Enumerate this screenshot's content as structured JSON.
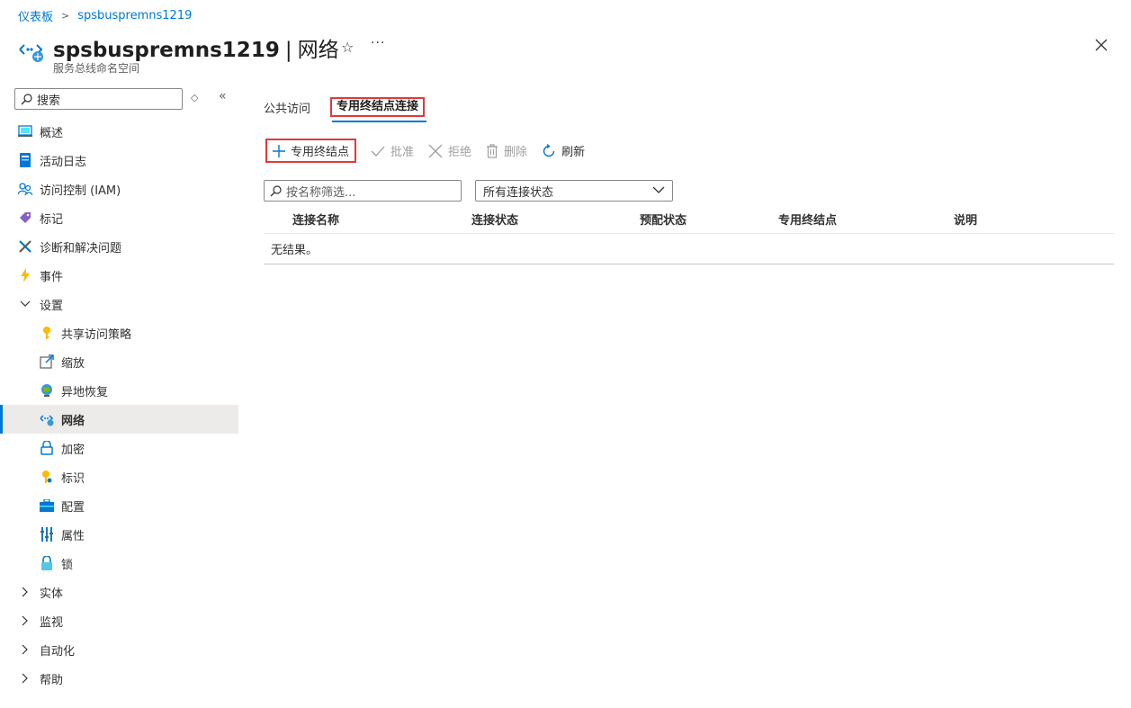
{
  "breadcrumb": {
    "home": "仪表板",
    "current": "spsbuspremns1219"
  },
  "header": {
    "resource_name": "spsbuspremns1219",
    "separator": "|",
    "page_name": "网络",
    "subtitle": "服务总线命名空间",
    "star": "☆",
    "more": "···"
  },
  "sidebar": {
    "search_placeholder": "搜索",
    "items": [
      {
        "label": "概述",
        "icon": "overview-icon"
      },
      {
        "label": "活动日志",
        "icon": "activity-log-icon"
      },
      {
        "label": "访问控制 (IAM)",
        "icon": "iam-icon"
      },
      {
        "label": "标记",
        "icon": "tag-icon"
      },
      {
        "label": "诊断和解决问题",
        "icon": "diagnose-icon"
      },
      {
        "label": "事件",
        "icon": "event-icon"
      },
      {
        "label": "设置",
        "icon": "chevron-down-icon"
      },
      {
        "label": "共享访问策略",
        "icon": "key-icon"
      },
      {
        "label": "缩放",
        "icon": "scale-icon"
      },
      {
        "label": "异地恢复",
        "icon": "geo-recovery-icon"
      },
      {
        "label": "网络",
        "icon": "network-icon"
      },
      {
        "label": "加密",
        "icon": "lock-icon"
      },
      {
        "label": "标识",
        "icon": "identity-icon"
      },
      {
        "label": "配置",
        "icon": "configuration-icon"
      },
      {
        "label": "属性",
        "icon": "properties-icon"
      },
      {
        "label": "锁",
        "icon": "lock-resource-icon"
      },
      {
        "label": "实体",
        "icon": "chevron-right-icon"
      },
      {
        "label": "监视",
        "icon": "chevron-right-icon"
      },
      {
        "label": "自动化",
        "icon": "chevron-right-icon"
      },
      {
        "label": "帮助",
        "icon": "chevron-right-icon"
      }
    ]
  },
  "tabs": [
    {
      "label": "公共访问"
    },
    {
      "label": "专用终结点连接"
    }
  ],
  "toolbar": {
    "add": "专用终结点",
    "approve": "批准",
    "reject": "拒绝",
    "delete": "删除",
    "refresh": "刷新"
  },
  "filter": {
    "name_placeholder": "按名称筛选...",
    "status_selected": "所有连接状态"
  },
  "table": {
    "columns": [
      "连接名称",
      "连接状态",
      "预配状态",
      "专用终结点",
      "说明"
    ],
    "empty_text": "无结果。"
  },
  "colors": {
    "accent": "#0078d4",
    "highlight_border": "#e03a3a",
    "active_bg": "#edebe9"
  }
}
